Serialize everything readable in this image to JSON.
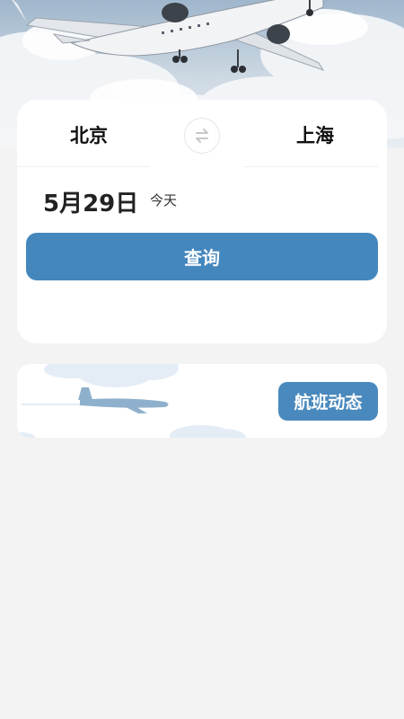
{
  "search": {
    "departure_city": "北京",
    "arrival_city": "上海",
    "date": "5月29日",
    "date_hint": "今天",
    "search_label": "查询"
  },
  "flight_status": {
    "button_label": "航班动态"
  },
  "colors": {
    "accent": "#4487bd",
    "background": "#f3f3f3",
    "card": "#ffffff"
  },
  "icons": {
    "swap": "swap-arrows-icon"
  }
}
